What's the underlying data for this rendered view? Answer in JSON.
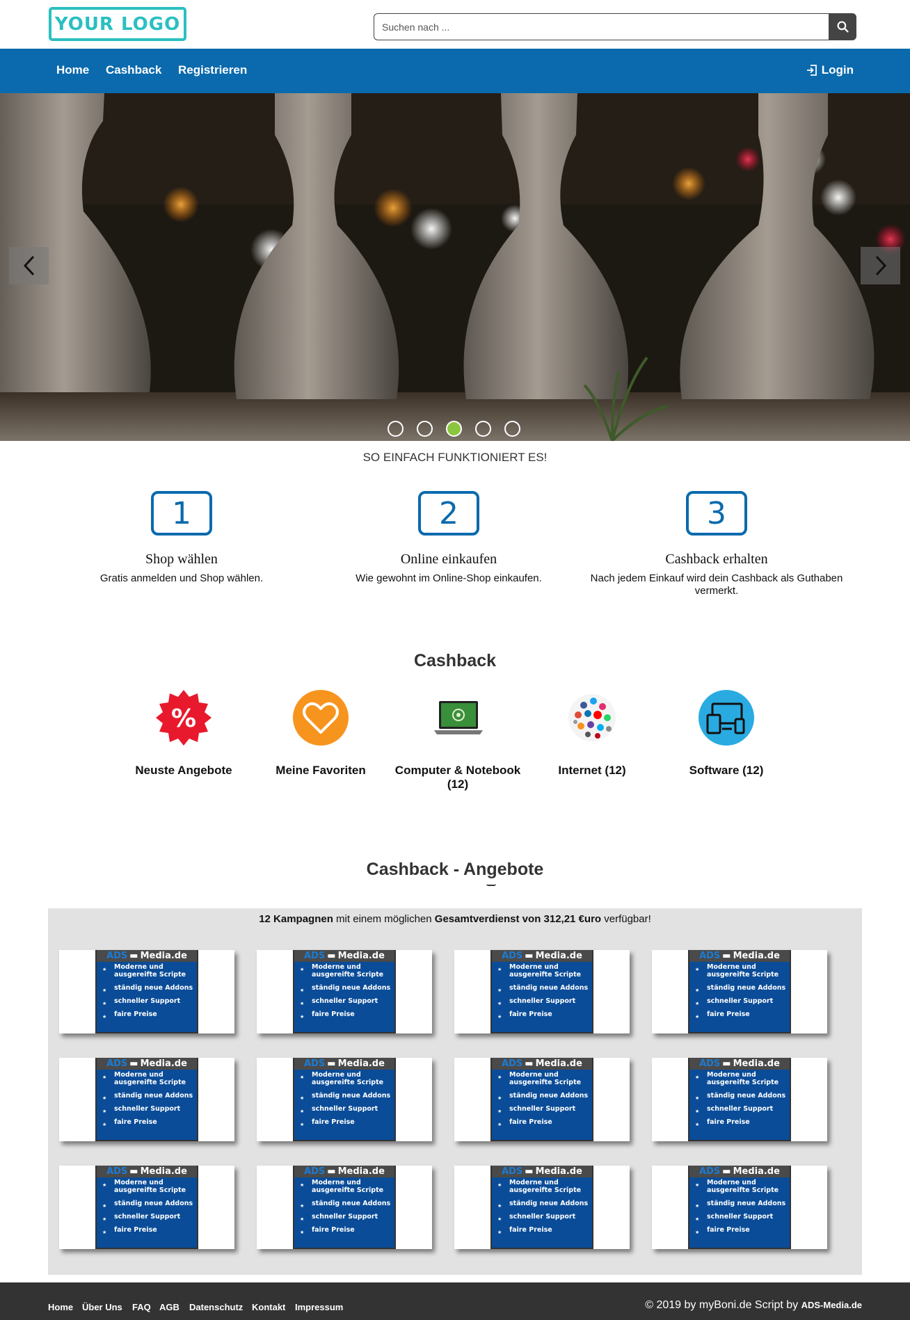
{
  "header": {
    "logo_text": "YOUR LOGO",
    "search_placeholder": "Suchen nach ..."
  },
  "nav": {
    "items": [
      "Home",
      "Cashback",
      "Registrieren"
    ],
    "login_label": "Login"
  },
  "slider": {
    "slide_count": 5,
    "active_index": 2
  },
  "how": {
    "title": "SO EINFACH FUNKTIONIERT ES!",
    "steps": [
      {
        "number": "1",
        "title": "Shop wählen",
        "text": "Gratis anmelden und Shop wählen."
      },
      {
        "number": "2",
        "title": "Online einkaufen",
        "text": "Wie gewohnt im Online-Shop einkaufen."
      },
      {
        "number": "3",
        "title": "Cashback erhalten",
        "text": "Nach jedem Einkauf wird dein Cashback als Guthaben vermerkt."
      }
    ]
  },
  "categories": {
    "title": "Cashback",
    "items": [
      {
        "label": "Neuste Angebote",
        "icon": "percent-badge-icon"
      },
      {
        "label": "Meine Favoriten",
        "icon": "heart-icon"
      },
      {
        "label": "Computer & Notebook (12)",
        "icon": "laptop-icon"
      },
      {
        "label": "Internet (12)",
        "icon": "social-cloud-icon"
      },
      {
        "label": "Software (12)",
        "icon": "devices-icon"
      }
    ]
  },
  "offers": {
    "title": "Cashback - Angebote",
    "summary_count": "12 Kampagnen",
    "summary_mid": " mit einem möglichen ",
    "summary_total": "Gesamtverdienst von 312,21 €uro",
    "summary_end": " verfügbar!",
    "card": {
      "brand_ads": "ADS",
      "brand_rest": "Media.de",
      "bullets": [
        "Moderne und ausgereifte Scripte",
        "ständig neue Addons",
        "schneller Support",
        "faire Preise"
      ]
    },
    "count": 12
  },
  "footer": {
    "links": [
      "Home",
      "Über Uns",
      "FAQ",
      "AGB",
      "Datenschutz",
      "Kontakt",
      "Impressum"
    ],
    "copyright": "© 2019 by myBoni.de Script by ",
    "copyright_brand": "ADS-Media.de"
  },
  "colors": {
    "brand_blue": "#0b6aad",
    "logo_teal": "#2bbfc1",
    "active_dot": "#8cc63f",
    "footer_bg": "#333333"
  }
}
